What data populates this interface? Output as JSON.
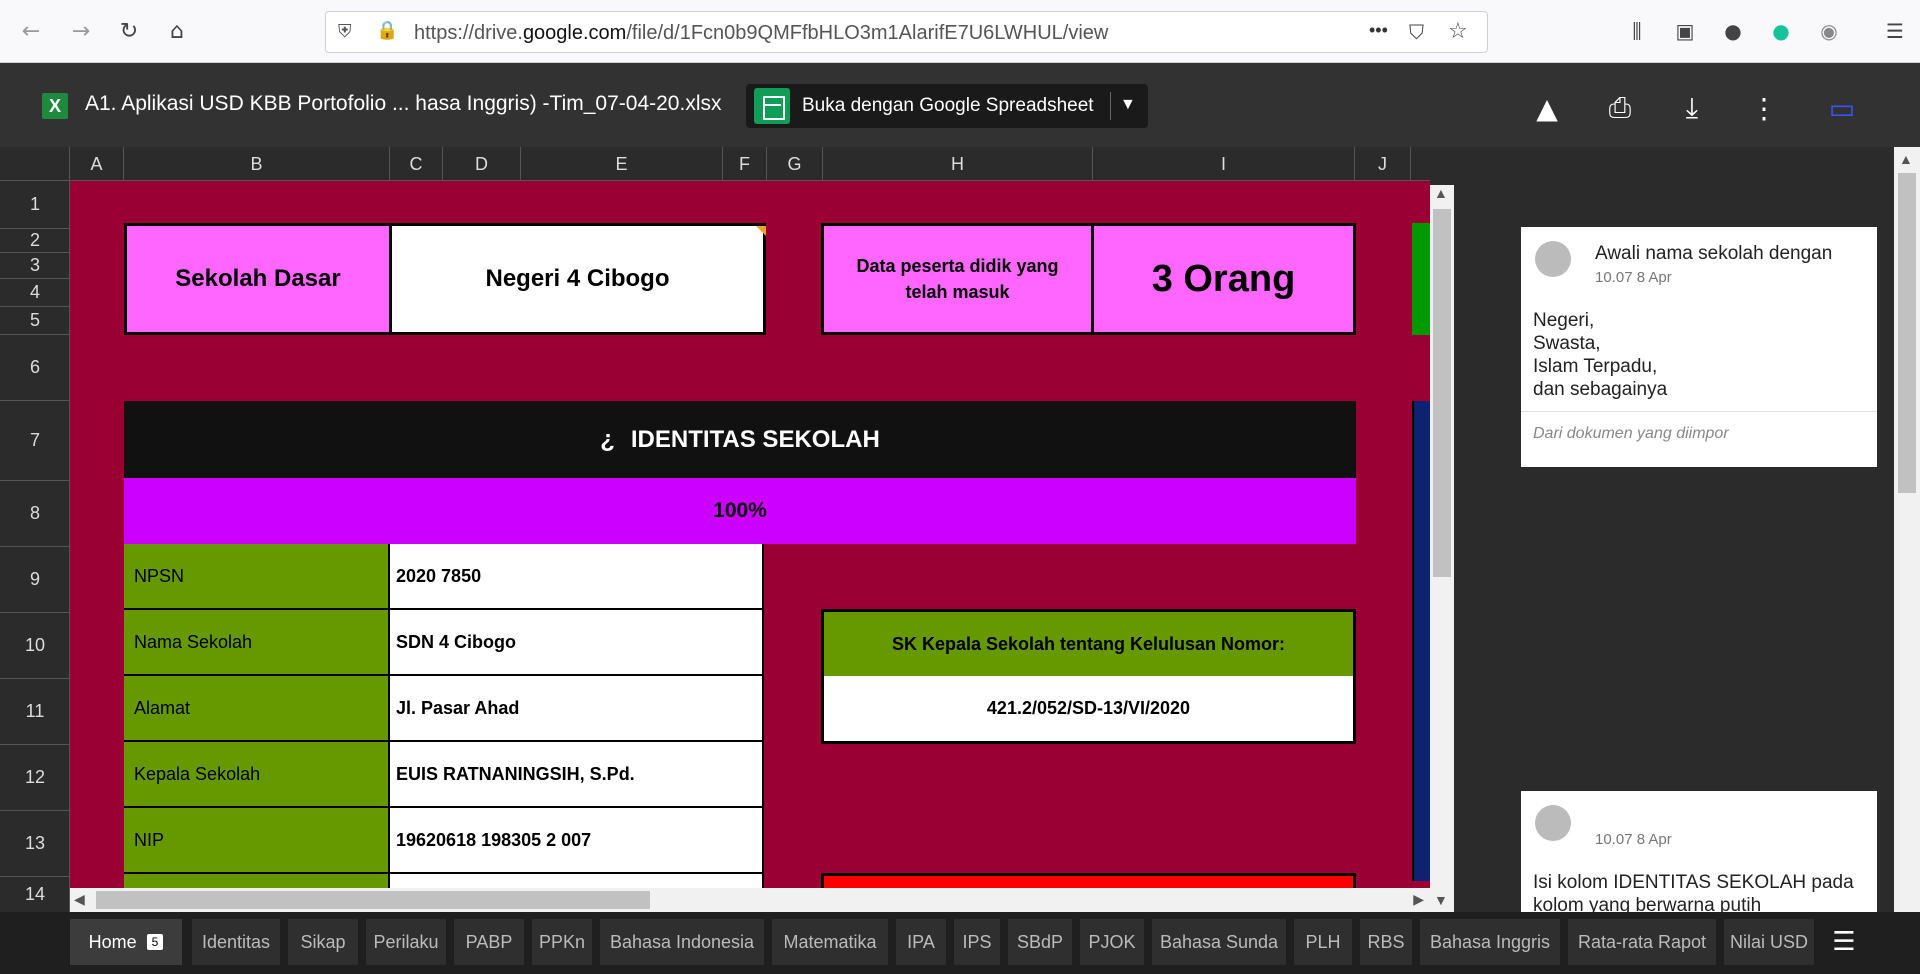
{
  "browser": {
    "url_prefix": "https://drive.",
    "url_domain": "google.com",
    "url_path": "/file/d/1Fcn0b9QMFfbHLO3m1AlarifE7U6LWHUL/view",
    "more_label": "•••"
  },
  "drive": {
    "file_icon": "X",
    "file_title": "A1. Aplikasi USD KBB Portofolio ... hasa Inggris) -Tim_07-04-20.xlsx",
    "open_with_label": "Buka dengan Google Spreadsheet"
  },
  "columns": [
    "A",
    "B",
    "C",
    "D",
    "E",
    "F",
    "G",
    "H",
    "I",
    "J"
  ],
  "rows": [
    "1",
    "2",
    "3",
    "4",
    "5",
    "6",
    "7",
    "8",
    "9",
    "10",
    "11",
    "12",
    "13",
    "14"
  ],
  "top": {
    "school_type": "Sekolah Dasar",
    "school_name": "Negeri 4 Cibogo",
    "students_label": "Data peserta didik yang telah masuk",
    "students_value": "3 Orang"
  },
  "identity": {
    "header_icon": "¿",
    "header": "IDENTITAS SEKOLAH",
    "progress": "100%",
    "rows": [
      {
        "label": "NPSN",
        "value": "2020 7850"
      },
      {
        "label": "Nama Sekolah",
        "value": "SDN 4 Cibogo"
      },
      {
        "label": "Alamat",
        "value": "Jl. Pasar Ahad"
      },
      {
        "label": "Kepala Sekolah",
        "value": "EUIS RATNANINGSIH, S.Pd."
      },
      {
        "label": "NIP",
        "value": "19620618 198305 2 007"
      }
    ]
  },
  "sk": {
    "label": "SK Kepala Sekolah tentang Kelulusan Nomor:",
    "value": "421.2/052/SD-13/VI/2020"
  },
  "comments": [
    {
      "title": "Awali nama sekolah dengan",
      "time": "10.07 8 Apr",
      "lines": [
        "Negeri,",
        "Swasta,",
        "Islam Terpadu,",
        "dan sebagainya"
      ],
      "footer": "Dari dokumen yang diimpor"
    },
    {
      "title": "",
      "time": "10.07 8 Apr",
      "lines": [
        "Isi kolom IDENTITAS SEKOLAH pada",
        "kolom yang berwarna putih"
      ],
      "footer": ""
    }
  ],
  "tabs": [
    {
      "label": "Home",
      "badge": "5"
    },
    {
      "label": "Identitas"
    },
    {
      "label": "Sikap"
    },
    {
      "label": "Perilaku"
    },
    {
      "label": "PABP"
    },
    {
      "label": "PPKn"
    },
    {
      "label": "Bahasa Indonesia"
    },
    {
      "label": "Matematika"
    },
    {
      "label": "IPA"
    },
    {
      "label": "IPS"
    },
    {
      "label": "SBdP"
    },
    {
      "label": "PJOK"
    },
    {
      "label": "Bahasa Sunda"
    },
    {
      "label": "PLH"
    },
    {
      "label": "RBS"
    },
    {
      "label": "Bahasa Inggris"
    },
    {
      "label": "Rata-rata Rapot"
    },
    {
      "label": "Nilai USD"
    }
  ],
  "colors": {
    "sheet_bg": "#9b0034",
    "pink": "#ff66ff",
    "green": "#669900",
    "purple": "#cc00ff",
    "red": "#ff0000"
  }
}
